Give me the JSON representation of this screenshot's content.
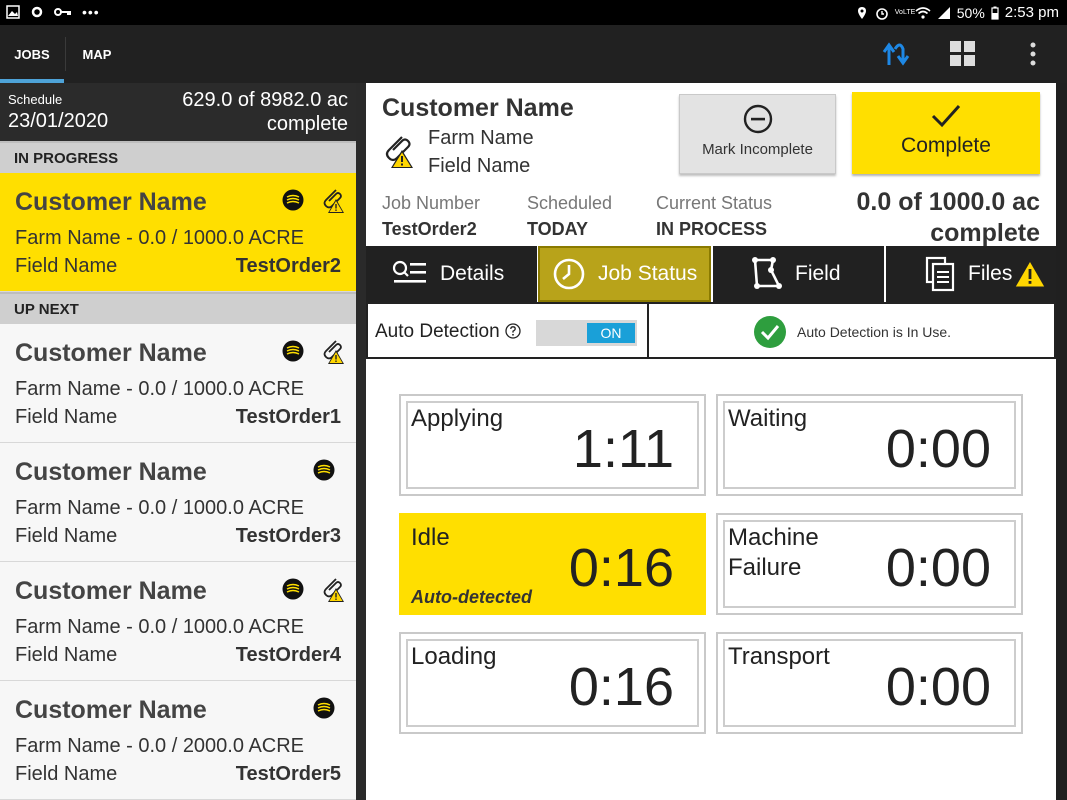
{
  "statusbar": {
    "battery": "50%",
    "time": "2:53 pm",
    "network": "VoLTE"
  },
  "appbar": {
    "tabs": [
      "JOBS",
      "MAP"
    ],
    "active_tab": "JOBS",
    "icons": [
      "sync-icon",
      "grid-icon",
      "more-vert-icon"
    ],
    "sync_color": "#1e88e5"
  },
  "schedule": {
    "label": "Schedule",
    "date": "23/01/2020",
    "progress_line1": "629.0 of 8982.0 ac",
    "progress_line2": "complete"
  },
  "sections": {
    "in_progress": "IN PROGRESS",
    "up_next": "UP NEXT"
  },
  "jobs": [
    {
      "customer": "Customer Name",
      "farm": "Farm Name - 0.0 / 1000.0 ACRE",
      "field": "Field Name",
      "order": "TestOrder2",
      "has_warning_clip": true,
      "active": true
    },
    {
      "customer": "Customer Name",
      "farm": "Farm Name - 0.0 / 1000.0 ACRE",
      "field": "Field Name",
      "order": "TestOrder1",
      "has_warning_clip": true
    },
    {
      "customer": "Customer Name",
      "farm": "Farm Name - 0.0 / 1000.0 ACRE",
      "field": "Field Name",
      "order": "TestOrder3",
      "has_warning_clip": false
    },
    {
      "customer": "Customer Name",
      "farm": "Farm Name - 0.0 / 1000.0 ACRE",
      "field": "Field Name",
      "order": "TestOrder4",
      "has_warning_clip": true
    },
    {
      "customer": "Customer Name",
      "farm": "Farm Name - 0.0 / 2000.0 ACRE",
      "field": "Field Name",
      "order": "TestOrder5",
      "has_warning_clip": false
    }
  ],
  "detail": {
    "customer": "Customer Name",
    "farm": "Farm Name",
    "field": "Field Name",
    "mark_incomplete": "Mark Incomplete",
    "complete": "Complete",
    "job_number_label": "Job Number",
    "job_number": "TestOrder2",
    "scheduled_label": "Scheduled",
    "scheduled": "TODAY",
    "status_label": "Current Status",
    "status": "IN PROCESS",
    "progress_line1": "0.0 of 1000.0 ac",
    "progress_line2": "complete"
  },
  "subtabs": {
    "details": "Details",
    "job_status": "Job Status",
    "field": "Field",
    "files": "Files",
    "active": "Job Status"
  },
  "auto_detection": {
    "label": "Auto Detection",
    "toggle": "ON",
    "status": "Auto Detection is In Use."
  },
  "timers": [
    {
      "name": "Applying",
      "value": "1:11"
    },
    {
      "name": "Waiting",
      "value": "0:00"
    },
    {
      "name": "Idle",
      "value": "0:16",
      "note": "Auto-detected",
      "highlight": true
    },
    {
      "name": "Machine\nFailure",
      "value": "0:00"
    },
    {
      "name": "Loading",
      "value": "0:16"
    },
    {
      "name": "Transport",
      "value": "0:00"
    }
  ],
  "colors": {
    "accent_yellow": "#ffdf00",
    "toggle_blue": "#1aa0d8",
    "success_green": "#2e9e3e",
    "warning_yellow": "#ffd600"
  }
}
